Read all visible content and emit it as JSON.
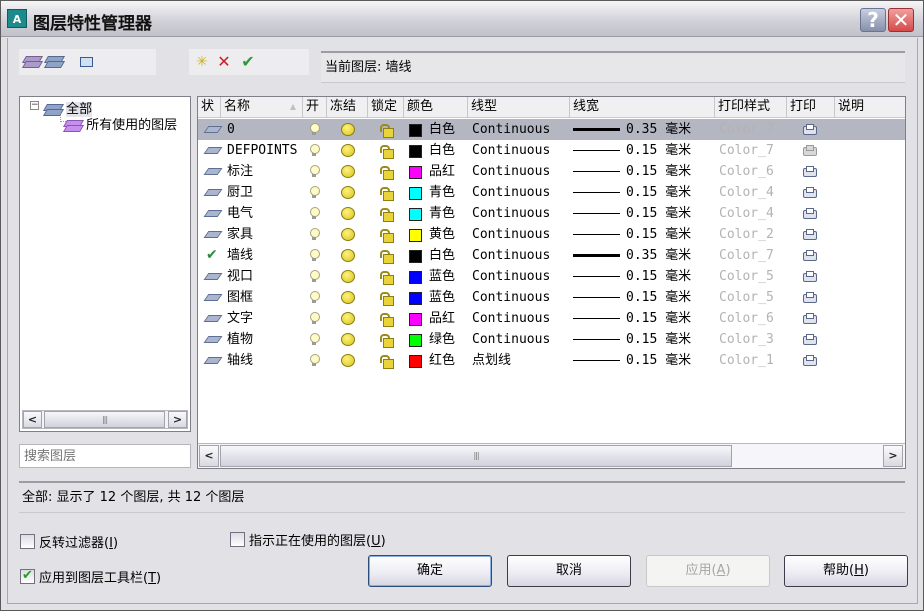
{
  "window": {
    "title": "图层特性管理器",
    "app_icon_label": "A",
    "help_label": "?",
    "close_label": "✕"
  },
  "toolbar": {
    "filter_tools": [
      {
        "name": "new-property-filter",
        "icon": "new-filter-icon"
      },
      {
        "name": "new-group-filter",
        "icon": "group-filter-icon"
      },
      {
        "name": "layer-states-manager",
        "icon": "layer-states-icon"
      }
    ],
    "layer_tools": [
      {
        "name": "new-layer",
        "icon": "new-layer-icon",
        "glyph": "✳"
      },
      {
        "name": "delete-layer",
        "icon": "delete-icon",
        "glyph": "✕",
        "color": "#c8202a"
      },
      {
        "name": "set-current",
        "icon": "checkmark-icon",
        "glyph": "✔",
        "color": "#2c9a3a"
      }
    ]
  },
  "current_layer": "当前图层: 墙线",
  "tree": {
    "root": {
      "label": "全部",
      "expander": "−"
    },
    "children": [
      {
        "label": "所有使用的图层"
      }
    ]
  },
  "search": {
    "placeholder": "搜索图层"
  },
  "grid": {
    "columns": [
      "状",
      "名称",
      "开",
      "冻结",
      "锁定",
      "颜色",
      "线型",
      "线宽",
      "打印样式",
      "打印",
      "说明"
    ],
    "rows": [
      {
        "status": "layer",
        "name": "0",
        "on": true,
        "frozen": false,
        "locked": false,
        "color_name": "白色",
        "color_hex": "#000000",
        "linetype": "Continuous",
        "lineweight": "0.35 毫米",
        "lw_heavy": true,
        "plot_style": "Color_7",
        "plot": true,
        "plot_dim": false,
        "description": "",
        "selected": true
      },
      {
        "status": "layer",
        "name": "DEFPOINTS",
        "on": true,
        "frozen": false,
        "locked": false,
        "color_name": "白色",
        "color_hex": "#000000",
        "linetype": "Continuous",
        "lineweight": "0.15 毫米",
        "lw_heavy": false,
        "plot_style": "Color_7",
        "plot": true,
        "plot_dim": true,
        "description": "",
        "selected": false
      },
      {
        "status": "layer",
        "name": "标注",
        "on": true,
        "frozen": false,
        "locked": false,
        "color_name": "品红",
        "color_hex": "#ff00ff",
        "linetype": "Continuous",
        "lineweight": "0.15 毫米",
        "lw_heavy": false,
        "plot_style": "Color_6",
        "plot": true,
        "plot_dim": false,
        "description": "",
        "selected": false
      },
      {
        "status": "layer",
        "name": "厨卫",
        "on": true,
        "frozen": false,
        "locked": false,
        "color_name": "青色",
        "color_hex": "#00ffff",
        "linetype": "Continuous",
        "lineweight": "0.15 毫米",
        "lw_heavy": false,
        "plot_style": "Color_4",
        "plot": true,
        "plot_dim": false,
        "description": "",
        "selected": false
      },
      {
        "status": "layer",
        "name": "电气",
        "on": true,
        "frozen": false,
        "locked": false,
        "color_name": "青色",
        "color_hex": "#00ffff",
        "linetype": "Continuous",
        "lineweight": "0.15 毫米",
        "lw_heavy": false,
        "plot_style": "Color_4",
        "plot": true,
        "plot_dim": false,
        "description": "",
        "selected": false
      },
      {
        "status": "layer",
        "name": "家具",
        "on": true,
        "frozen": false,
        "locked": false,
        "color_name": "黄色",
        "color_hex": "#ffff00",
        "linetype": "Continuous",
        "lineweight": "0.15 毫米",
        "lw_heavy": false,
        "plot_style": "Color_2",
        "plot": true,
        "plot_dim": false,
        "description": "",
        "selected": false
      },
      {
        "status": "current",
        "name": "墙线",
        "on": true,
        "frozen": false,
        "locked": false,
        "color_name": "白色",
        "color_hex": "#000000",
        "linetype": "Continuous",
        "lineweight": "0.35 毫米",
        "lw_heavy": true,
        "plot_style": "Color_7",
        "plot": true,
        "plot_dim": false,
        "description": "",
        "selected": false
      },
      {
        "status": "layer",
        "name": "视口",
        "on": true,
        "frozen": false,
        "locked": false,
        "color_name": "蓝色",
        "color_hex": "#0000ff",
        "linetype": "Continuous",
        "lineweight": "0.15 毫米",
        "lw_heavy": false,
        "plot_style": "Color_5",
        "plot": true,
        "plot_dim": false,
        "description": "",
        "selected": false
      },
      {
        "status": "layer",
        "name": "图框",
        "on": true,
        "frozen": false,
        "locked": false,
        "color_name": "蓝色",
        "color_hex": "#0000ff",
        "linetype": "Continuous",
        "lineweight": "0.15 毫米",
        "lw_heavy": false,
        "plot_style": "Color_5",
        "plot": true,
        "plot_dim": false,
        "description": "",
        "selected": false
      },
      {
        "status": "layer",
        "name": "文字",
        "on": true,
        "frozen": false,
        "locked": false,
        "color_name": "品红",
        "color_hex": "#ff00ff",
        "linetype": "Continuous",
        "lineweight": "0.15 毫米",
        "lw_heavy": false,
        "plot_style": "Color_6",
        "plot": true,
        "plot_dim": false,
        "description": "",
        "selected": false
      },
      {
        "status": "layer",
        "name": "植物",
        "on": true,
        "frozen": false,
        "locked": false,
        "color_name": "绿色",
        "color_hex": "#00ff00",
        "linetype": "Continuous",
        "lineweight": "0.15 毫米",
        "lw_heavy": false,
        "plot_style": "Color_3",
        "plot": true,
        "plot_dim": false,
        "description": "",
        "selected": false
      },
      {
        "status": "layer",
        "name": "轴线",
        "on": true,
        "frozen": false,
        "locked": false,
        "color_name": "红色",
        "color_hex": "#ff0000",
        "linetype": "点划线",
        "lineweight": "0.15 毫米",
        "lw_heavy": false,
        "plot_style": "Color_1",
        "plot": true,
        "plot_dim": false,
        "description": "",
        "selected": false
      }
    ]
  },
  "scroll": {
    "left": "<",
    "right": ">",
    "grip": "|||"
  },
  "status_text": "全部: 显示了 12 个图层, 共 12 个图层",
  "options": {
    "invert_filter": {
      "label": "反转过滤器",
      "key": "I",
      "checked": false
    },
    "indicate_in_use": {
      "label": "指示正在使用的图层",
      "key": "U",
      "checked": false
    },
    "apply_to_toolbar": {
      "label": "应用到图层工具栏",
      "key": "T",
      "checked": true
    }
  },
  "buttons": {
    "ok": "确定",
    "cancel": "取消",
    "apply": "应用",
    "apply_key": "A",
    "help": "帮助",
    "help_key": "H"
  }
}
